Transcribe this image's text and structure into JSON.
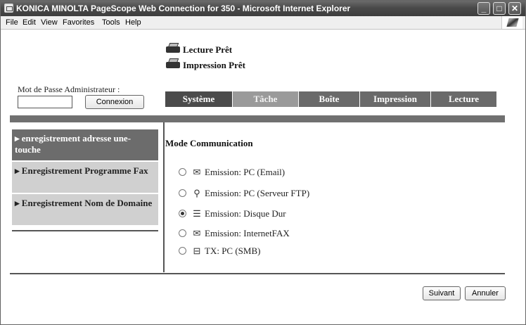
{
  "window": {
    "title": "KONICA MINOLTA PageScope Web Connection for 350 - Microsoft Internet Explorer",
    "controls": {
      "minimize": "_",
      "maximize": "□",
      "close": "✕"
    }
  },
  "menubar": {
    "items": [
      "File",
      "Edit",
      "View",
      "Favorites",
      "Tools",
      "Help"
    ]
  },
  "status": {
    "scan": "Lecture Prêt",
    "print": "Impression Prêt"
  },
  "login": {
    "label": "Mot de Passe Administrateur :",
    "password_value": "",
    "button": "Connexion"
  },
  "tabs": [
    {
      "label": "Système",
      "state": "active"
    },
    {
      "label": "Tâche",
      "state": "inactive"
    },
    {
      "label": "Boîte",
      "state": "dark"
    },
    {
      "label": "Impression",
      "state": "dark"
    },
    {
      "label": "Lecture",
      "state": "dark"
    }
  ],
  "sidebar": {
    "items": [
      {
        "label": "enregistrement adresse une-touche",
        "active": true
      },
      {
        "label": "Enregistrement Programme Fax",
        "active": false
      },
      {
        "label": "Enregistrement Nom de Domaine",
        "active": false
      }
    ]
  },
  "main": {
    "title": "Mode Communication",
    "options": [
      {
        "icon": "email-icon",
        "glyph": "✉",
        "label": "Emission: PC (Email)",
        "checked": false
      },
      {
        "icon": "ftp-icon",
        "glyph": "⚲",
        "label": "Emission: PC (Serveur FTP)",
        "checked": false
      },
      {
        "icon": "harddisk-icon",
        "glyph": "☰",
        "label": "Emission: Disque Dur",
        "checked": true
      },
      {
        "icon": "internetfax-icon",
        "glyph": "✉",
        "label": "Emission: InternetFAX",
        "checked": false
      },
      {
        "icon": "smb-icon",
        "glyph": "⊟",
        "label": "TX: PC (SMB)",
        "checked": false
      }
    ]
  },
  "footer": {
    "next": "Suivant",
    "cancel": "Annuler"
  }
}
